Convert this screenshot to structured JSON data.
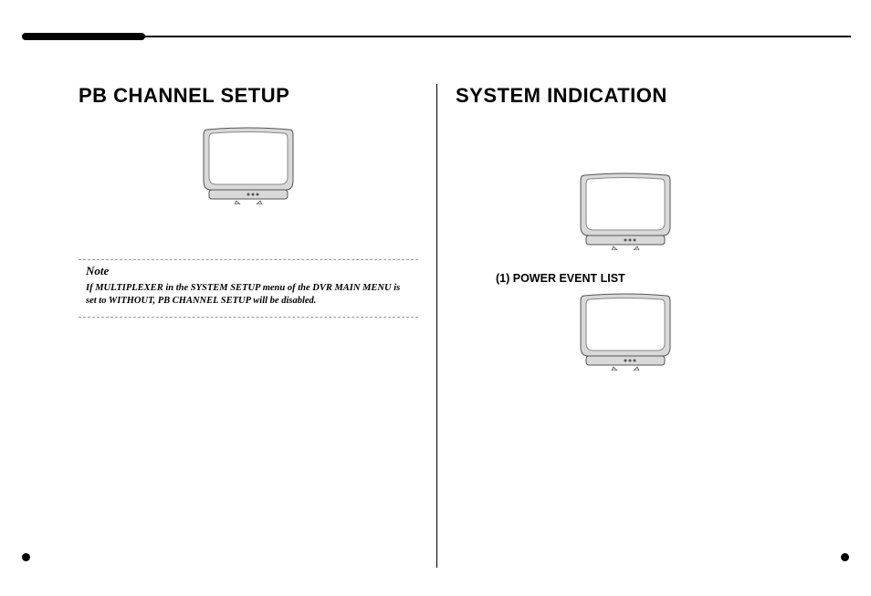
{
  "left": {
    "title": "PB CHANNEL SETUP",
    "note_label": "Note",
    "note_text": "If MULTIPLEXER in the SYSTEM SETUP menu of the DVR MAIN MENU is set to WITHOUT, PB CHANNEL SETUP will be disabled."
  },
  "right": {
    "title": "SYSTEM INDICATION",
    "subsection_1": "(1) POWER EVENT LIST"
  }
}
